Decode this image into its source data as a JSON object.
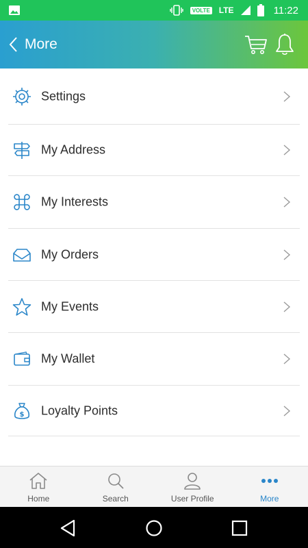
{
  "status_bar": {
    "network_badge": "VOLTE",
    "signal_type": "LTE",
    "time": "11:22"
  },
  "header": {
    "title": "More"
  },
  "menu": [
    {
      "label": "Settings",
      "icon": "gear-icon"
    },
    {
      "label": "My Address",
      "icon": "signpost-icon"
    },
    {
      "label": "My Interests",
      "icon": "command-icon"
    },
    {
      "label": "My Orders",
      "icon": "inbox-icon"
    },
    {
      "label": "My Events",
      "icon": "star-icon"
    },
    {
      "label": "My Wallet",
      "icon": "wallet-icon"
    },
    {
      "label": "Loyalty Points",
      "icon": "money-bag-icon"
    }
  ],
  "tabs": [
    {
      "label": "Home",
      "icon": "home-icon"
    },
    {
      "label": "Search",
      "icon": "search-icon"
    },
    {
      "label": "User Profile",
      "icon": "user-icon"
    },
    {
      "label": "More",
      "icon": "more-dots-icon",
      "active": true
    }
  ],
  "colors": {
    "status_bar": "#20c45a",
    "header_start": "#2a9fd0",
    "header_end": "#6cc63c",
    "accent": "#2a86c9",
    "divider": "#e2e2e2"
  }
}
